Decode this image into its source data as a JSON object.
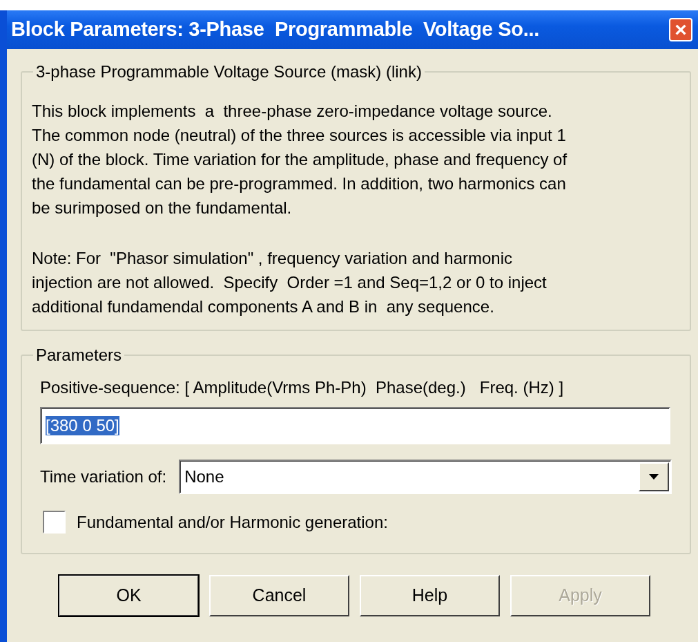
{
  "window": {
    "title": "Block Parameters: 3-Phase  Programmable  Voltage So...",
    "close": "×"
  },
  "description_group": {
    "legend": "3-phase Programmable Voltage Source (mask) (link)",
    "paragraphs": [
      [
        "This block implements  a  three-phase zero-impedance voltage source.",
        "The common node (neutral) of the three sources is accessible via input 1",
        "(N) of the block. Time variation for the amplitude, phase and frequency of",
        "the fundamental can be pre-programmed. In addition, two harmonics can",
        "be surimposed on the fundamental."
      ],
      [
        "Note: For  \"Phasor simulation\" , frequency variation and harmonic",
        "injection are not allowed.  Specify  Order =1 and Seq=1,2 or 0 to inject",
        "additional fundamendal components A and B in  any sequence."
      ]
    ]
  },
  "parameters_group": {
    "legend": "Parameters",
    "positive_sequence": {
      "label": "Positive-sequence: [ Amplitude(Vrms Ph-Ph)  Phase(deg.)   Freq. (Hz) ]",
      "value": "[380 0 50]",
      "value_selected": true
    },
    "time_variation": {
      "label": "Time variation of:",
      "value": "None"
    },
    "harmonic_generation": {
      "label": "Fundamental and/or Harmonic generation:",
      "checked": false
    }
  },
  "buttons": [
    {
      "label": "OK",
      "default": true,
      "disabled": false
    },
    {
      "label": "Cancel",
      "default": false,
      "disabled": false
    },
    {
      "label": "Help",
      "default": false,
      "disabled": false
    },
    {
      "label": "Apply",
      "default": false,
      "disabled": true
    }
  ]
}
